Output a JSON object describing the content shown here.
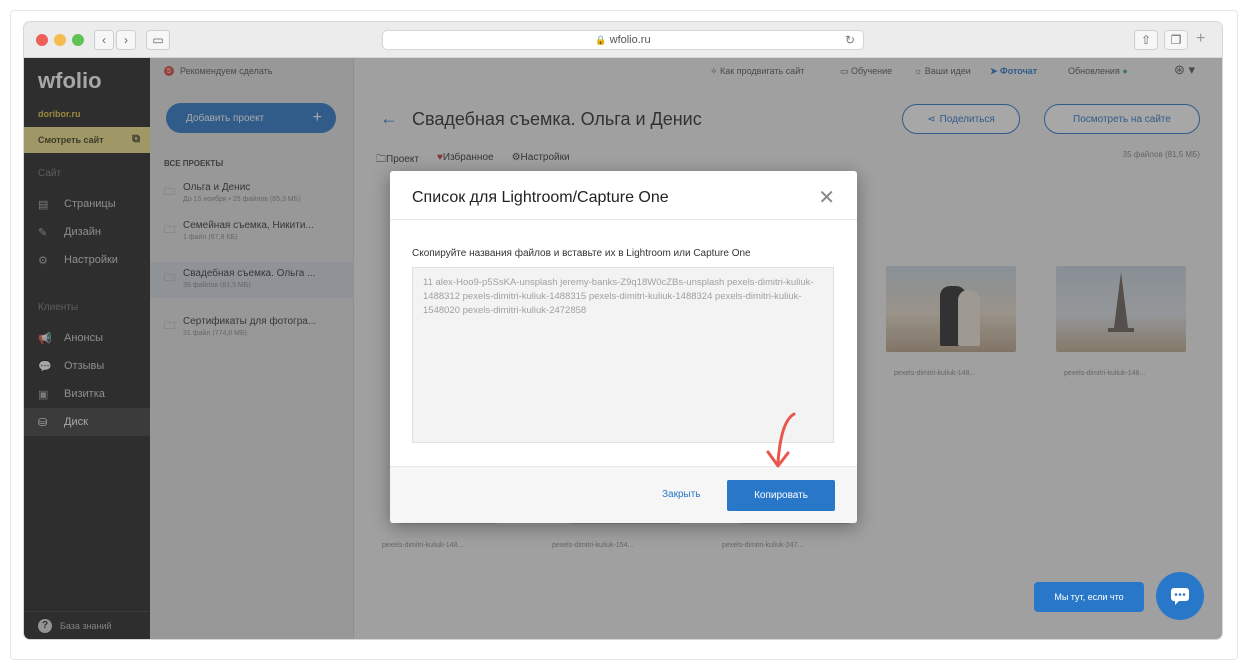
{
  "browser": {
    "url": "wfolio.ru"
  },
  "sidebar": {
    "logo": "wfolio",
    "site_name": "doribor.ru",
    "view_site": "Смотреть сайт",
    "section_site": "Сайт",
    "items_site": [
      {
        "label": "Страницы",
        "icon": "page-icon"
      },
      {
        "label": "Дизайн",
        "icon": "brush-icon"
      },
      {
        "label": "Настройки",
        "icon": "gear-icon"
      }
    ],
    "section_clients": "Клиенты",
    "items_clients": [
      {
        "label": "Анонсы",
        "icon": "megaphone-icon"
      },
      {
        "label": "Отзывы",
        "icon": "chat-icon"
      },
      {
        "label": "Визитка",
        "icon": "card-icon"
      },
      {
        "label": "Диск",
        "icon": "disk-icon"
      }
    ],
    "knowledge_base": "База знаний"
  },
  "projects": {
    "recommend": "Рекомендуем сделать",
    "add_button": "Добавить проект",
    "header": "ВСЕ ПРОЕКТЫ",
    "list": [
      {
        "name": "Ольга и Денис",
        "meta": "До 15 ноября • 25 файлов (65,3 МБ)"
      },
      {
        "name": "Семейная съемка, Никити...",
        "meta": "1 файл (67,8 КБ)"
      },
      {
        "name": "Свадебная съемка. Ольга ...",
        "meta": "35 файлов (81,5 МБ)"
      },
      {
        "name": "Сертификаты для фотогра...",
        "meta": "31 файл (774,8 МБ)"
      }
    ]
  },
  "topbar": {
    "promote": "Как продвигать сайт",
    "learning": "Обучение",
    "ideas": "Ваши идеи",
    "photochat": "Фоточат",
    "updates": "Обновления"
  },
  "main": {
    "title": "Свадебная съемка. Ольга и Денис",
    "share": "Поделиться",
    "view_on_site": "Посмотреть на сайте",
    "files_count": "35 файлов (81,5 МБ)",
    "tabs": [
      "Проект",
      "Избранное",
      "Настройки"
    ],
    "captions": [
      "pexels-dimitri-kuliuk-148...",
      "pexels-dimitri-kuliuk-148...",
      "pexels-dimitri-kuliuk-148...",
      "pexels-dimitri-kuliuk-154...",
      "pexels-dimitri-kuliuk-247..."
    ]
  },
  "modal": {
    "title": "Список для Lightroom/Capture One",
    "hint": "Скопируйте названия файлов и вставьте их в Lightroom или Capture One",
    "text": "11 alex-Hoo9-p5SsKA-unsplash jeremy-banks-Z9q18W0cZBs-unsplash pexels-dimitri-kuliuk-1488312 pexels-dimitri-kuliuk-1488315 pexels-dimitri-kuliuk-1488324 pexels-dimitri-kuliuk-1548020 pexels-dimitri-kuliuk-2472858",
    "close": "Закрыть",
    "copy": "Копировать"
  },
  "chat": {
    "bubble": "Мы тут, если что"
  },
  "colors": {
    "accent": "#2877c9",
    "sidebar": "#242424",
    "highlight": "#f3e28a"
  }
}
